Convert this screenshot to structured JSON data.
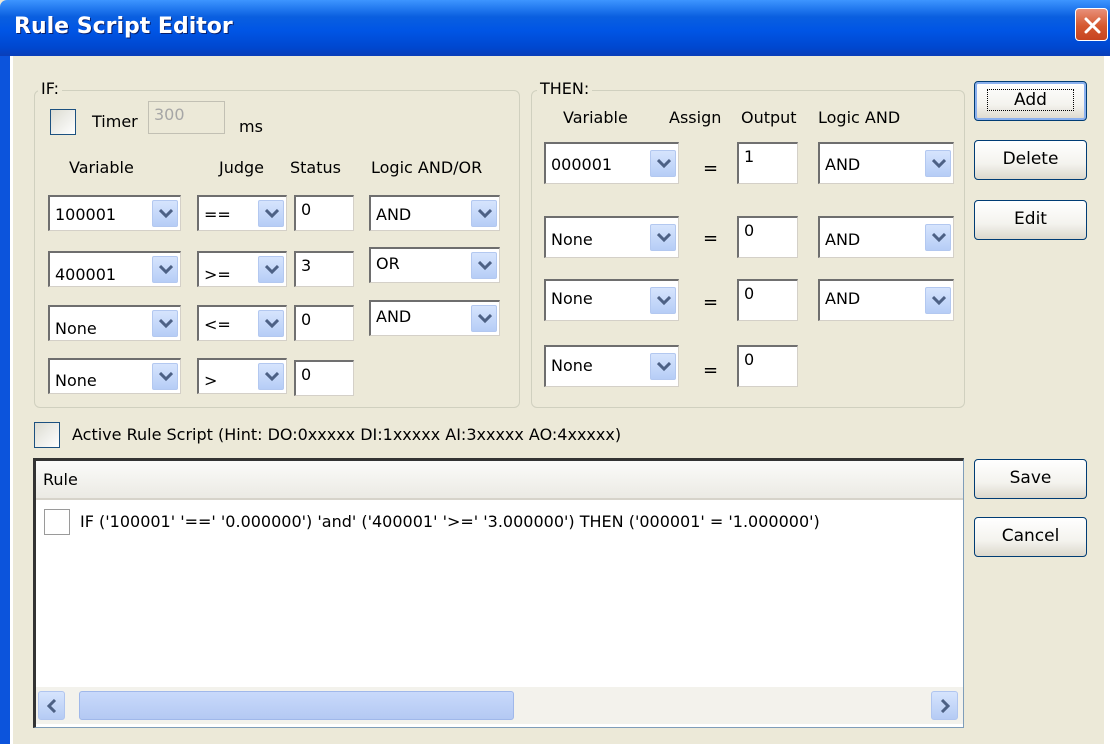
{
  "window": {
    "title": "Rule Script Editor",
    "accent": "#0055e5"
  },
  "if_group": {
    "legend": "IF:",
    "timer_label": "Timer",
    "timer_value": "300",
    "timer_unit": "ms",
    "timer_checked": false,
    "headers": {
      "variable": "Variable",
      "judge": "Judge",
      "status": "Status",
      "logic": "Logic AND/OR"
    },
    "rows": [
      {
        "variable": "100001",
        "judge": "==",
        "status": "0",
        "logic": "AND"
      },
      {
        "variable": "400001",
        "judge": ">=",
        "status": "3",
        "logic": "OR"
      },
      {
        "variable": "None",
        "judge": "<=",
        "status": "0",
        "logic": "AND"
      },
      {
        "variable": "None",
        "judge": ">",
        "status": "0"
      }
    ]
  },
  "then_group": {
    "legend": "THEN:",
    "headers": {
      "variable": "Variable",
      "assign": "Assign",
      "output": "Output",
      "logic": "Logic AND"
    },
    "assign_symbol": "=",
    "rows": [
      {
        "variable": "000001",
        "output": "1",
        "logic": "AND"
      },
      {
        "variable": "None",
        "output": "0",
        "logic": "AND"
      },
      {
        "variable": "None",
        "output": "0",
        "logic": "AND"
      },
      {
        "variable": "None",
        "output": "0"
      }
    ]
  },
  "buttons": {
    "add": "Add",
    "delete": "Delete",
    "edit": "Edit",
    "save": "Save",
    "cancel": "Cancel"
  },
  "active_rule": {
    "label": "Active Rule Script (Hint: DO:0xxxxx  DI:1xxxxx  AI:3xxxxx  AO:4xxxxx)",
    "checked": false
  },
  "rule_list": {
    "column_header": "Rule",
    "items": [
      {
        "text": "IF ('100001' '==' '0.000000') 'and' ('400001' '>=' '3.000000') THEN ('000001' = '1.000000')",
        "checked": false
      }
    ]
  }
}
